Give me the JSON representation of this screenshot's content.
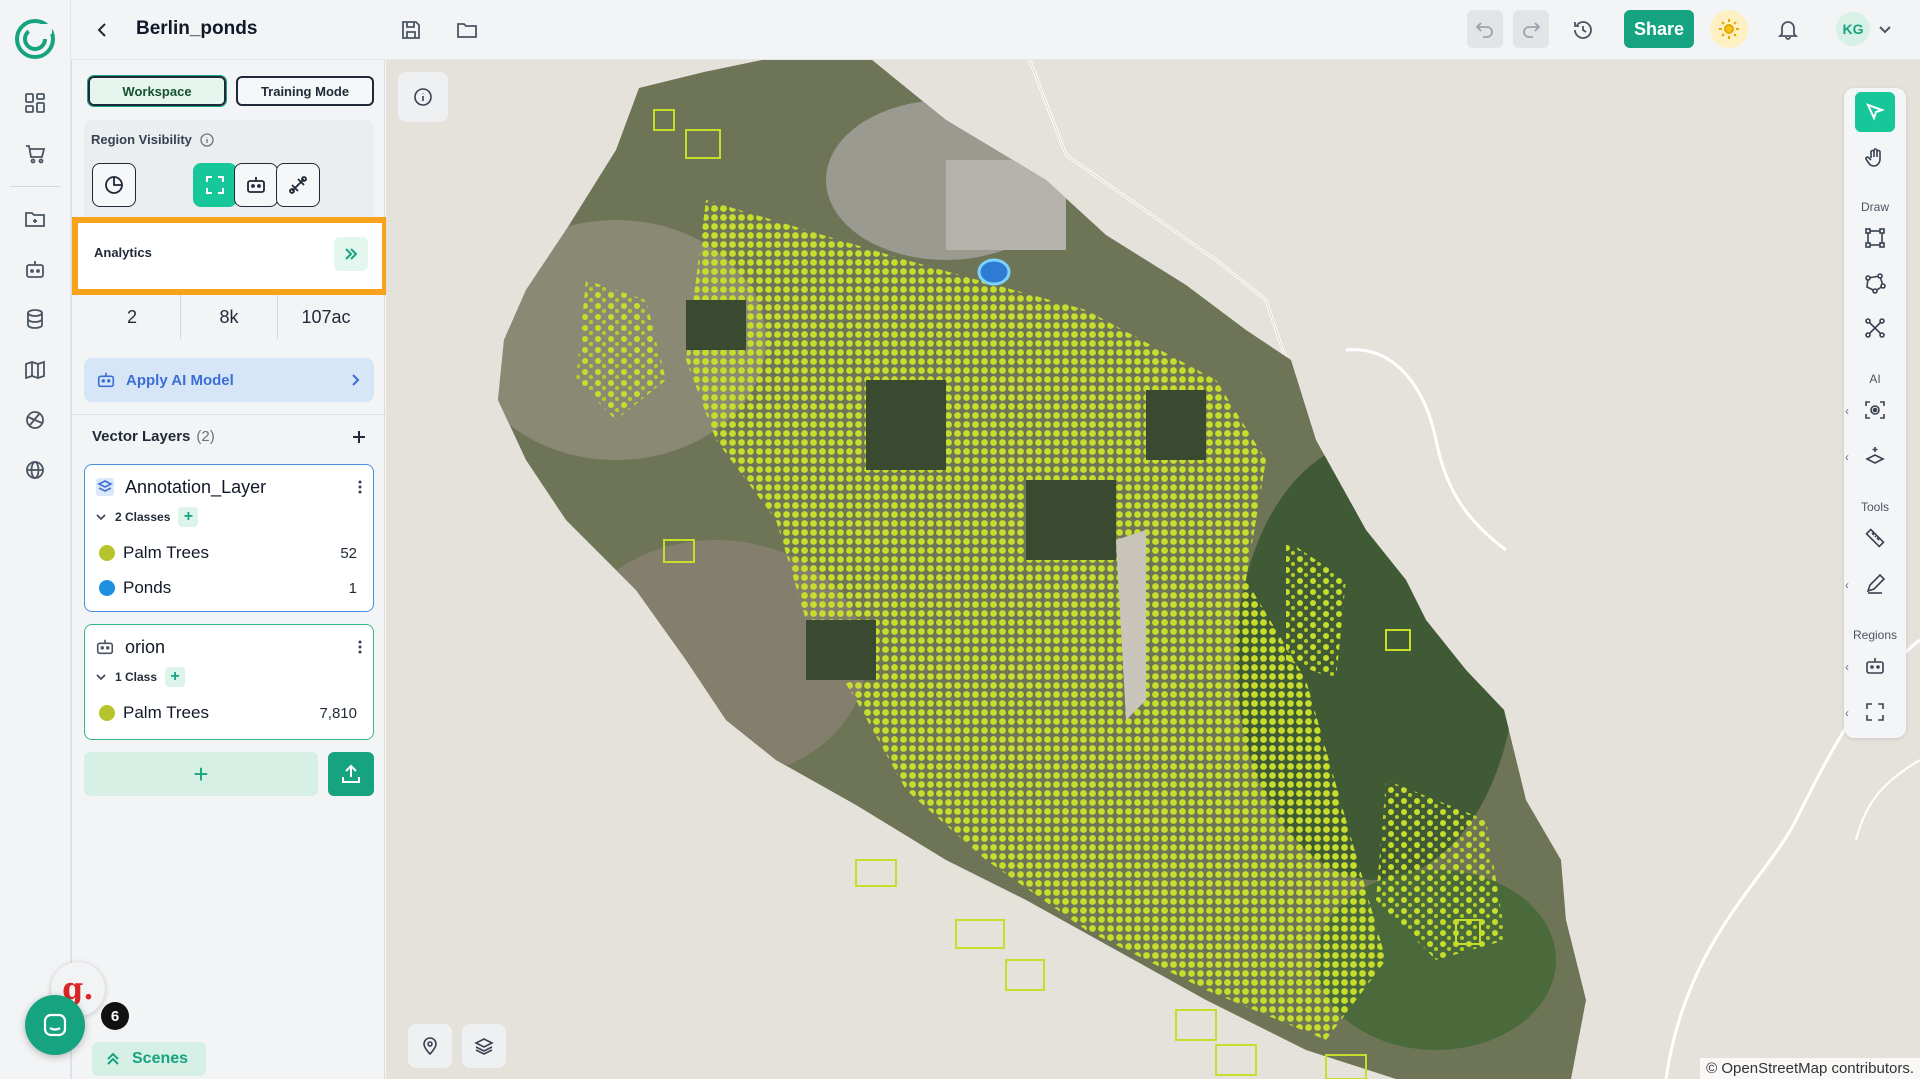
{
  "project": {
    "title": "Berlin_ponds"
  },
  "topbar": {
    "share_label": "Share",
    "avatar_initials": "KG"
  },
  "panel": {
    "modes": {
      "workspace": "Workspace",
      "training": "Training Mode"
    },
    "region_visibility": {
      "label": "Region Visibility"
    },
    "analytics": {
      "label": "Analytics"
    },
    "stats": [
      {
        "value": "2"
      },
      {
        "value": "8k"
      },
      {
        "value": "107ac"
      }
    ],
    "apply_ai": {
      "label": "Apply AI Model"
    },
    "vector_layers": {
      "label": "Vector Layers",
      "count": "(2)",
      "layers": [
        {
          "name": "Annotation_Layer",
          "classes_label": "2 Classes",
          "classes": [
            {
              "name": "Palm Trees",
              "count": "52",
              "color": "#b7c42c"
            },
            {
              "name": "Ponds",
              "count": "1",
              "color": "#1e90e0"
            }
          ]
        },
        {
          "name": "orion",
          "classes_label": "1 Class",
          "classes": [
            {
              "name": "Palm Trees",
              "count": "7,810",
              "color": "#b7c42c"
            }
          ]
        }
      ]
    },
    "scenes": {
      "label": "Scenes"
    }
  },
  "chat": {
    "badge": "g.",
    "count": "6"
  },
  "map": {
    "attribution": "© OpenStreetMap contributors."
  },
  "toolbar": {
    "sections": {
      "draw": "Draw",
      "ai": "AI",
      "tools": "Tools",
      "regions": "Regions"
    }
  },
  "colors": {
    "accent": "#16a37f",
    "highlight": "#f7a21b",
    "detection": "#c6dd2c"
  }
}
